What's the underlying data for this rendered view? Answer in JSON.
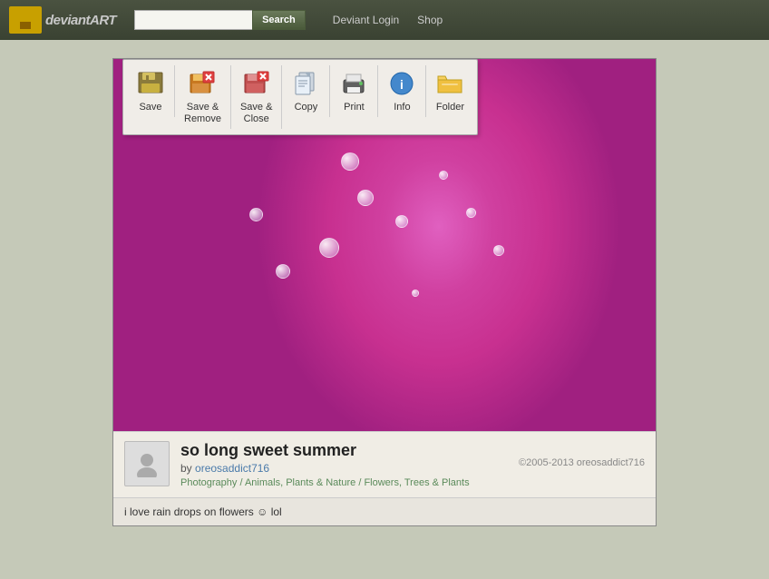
{
  "header": {
    "logo_icon": "da",
    "logo_text_part1": "deviant",
    "logo_text_part2": "ART",
    "search_placeholder": "",
    "search_button_label": "Search",
    "nav_links": [
      {
        "label": "Deviant Login",
        "id": "deviant-login"
      },
      {
        "label": "Shop",
        "id": "shop"
      }
    ]
  },
  "toolbar": {
    "items": [
      {
        "id": "save",
        "label": "Save",
        "icon": "💾"
      },
      {
        "id": "save-remove",
        "label_line1": "Save &",
        "label_line2": "Remove",
        "icon": "📤"
      },
      {
        "id": "save-close",
        "label_line1": "Save &",
        "label_line2": "Close",
        "icon": "📋"
      },
      {
        "id": "copy",
        "label": "Copy",
        "icon": "📄"
      },
      {
        "id": "print",
        "label": "Print",
        "icon": "🖨️"
      },
      {
        "id": "info",
        "label": "Info",
        "icon": "ℹ️"
      },
      {
        "id": "folder",
        "label": "Folder",
        "icon": "📁"
      }
    ]
  },
  "artwork": {
    "title": "so long sweet summer",
    "by_label": "by",
    "author": "oreosaddict716",
    "categories": {
      "cat1": "Photography",
      "sep1": " / ",
      "cat2": "Animals, Plants & Nature",
      "sep2": " / ",
      "cat3": "Flowers, Trees & Plants"
    },
    "copyright": "©2005-2013 oreosaddict716"
  },
  "comment": {
    "text": "i love rain drops on flowers",
    "emoji": "☺",
    "text2": " lol"
  }
}
